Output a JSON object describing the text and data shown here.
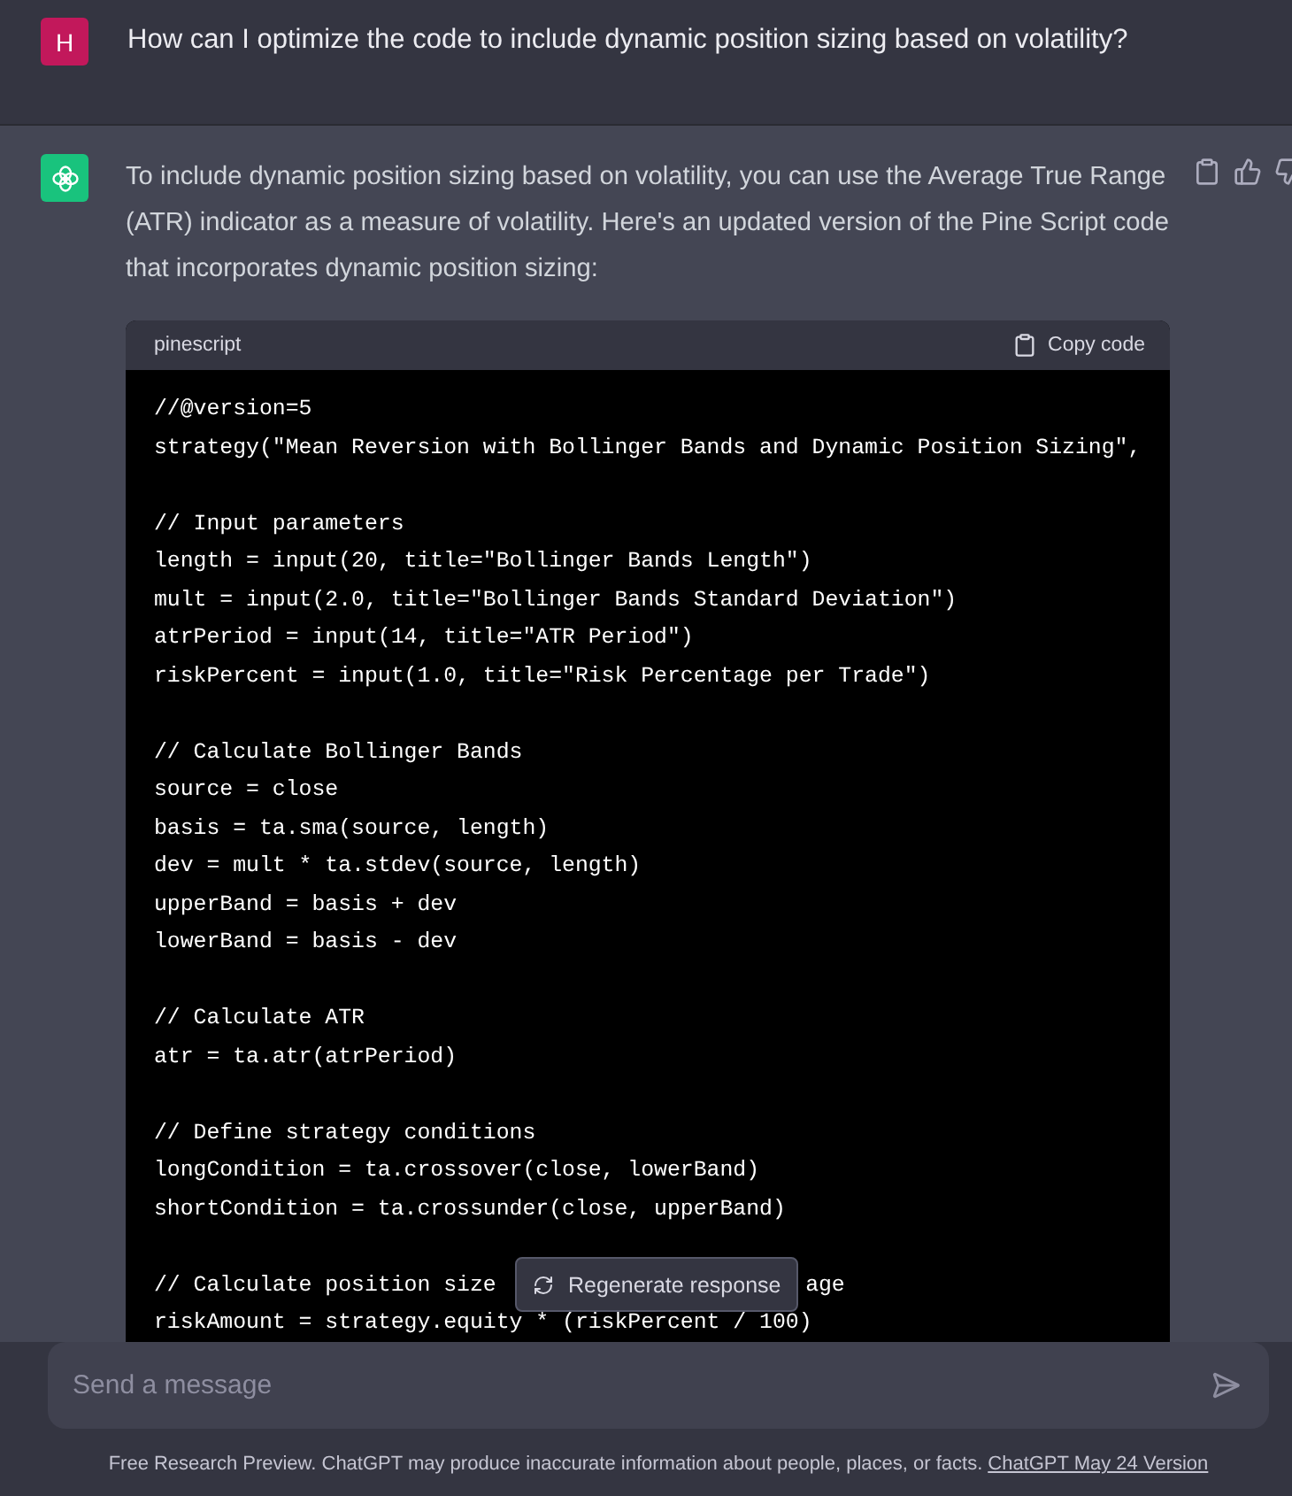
{
  "user_message": {
    "avatar": "H",
    "text": "How can I optimize the code to include dynamic position sizing based on volatility?"
  },
  "assistant_message": {
    "text": "To include dynamic position sizing based on volatility, you can use the Average True Range (ATR) indicator as a measure of volatility. Here's an updated version of the Pine Script code that incorporates dynamic position sizing:",
    "code_block": {
      "language": "pinescript",
      "copy_label": "Copy code",
      "lines": [
        {
          "kind": "code",
          "text": "//@version=5"
        },
        {
          "kind": "code",
          "text": "strategy(\"Mean Reversion with Bollinger Bands and Dynamic Position Sizing\","
        },
        {
          "kind": "blank"
        },
        {
          "kind": "code",
          "text": "// Input parameters"
        },
        {
          "kind": "code",
          "text": "length = input(20, title=\"Bollinger Bands Length\")"
        },
        {
          "kind": "code",
          "text": "mult = input(2.0, title=\"Bollinger Bands Standard Deviation\")"
        },
        {
          "kind": "code",
          "text": "atrPeriod = input(14, title=\"ATR Period\")"
        },
        {
          "kind": "code",
          "text": "riskPercent = input(1.0, title=\"Risk Percentage per Trade\")"
        },
        {
          "kind": "blank"
        },
        {
          "kind": "code",
          "text": "// Calculate Bollinger Bands"
        },
        {
          "kind": "code",
          "text": "source = close"
        },
        {
          "kind": "code",
          "text": "basis = ta.sma(source, length)"
        },
        {
          "kind": "code",
          "text": "dev = mult * ta.stdev(source, length)"
        },
        {
          "kind": "code",
          "text": "upperBand = basis + dev"
        },
        {
          "kind": "code",
          "text": "lowerBand = basis - dev"
        },
        {
          "kind": "blank"
        },
        {
          "kind": "code",
          "text": "// Calculate ATR"
        },
        {
          "kind": "code",
          "text": "atr = ta.atr(atrPeriod)"
        },
        {
          "kind": "blank"
        },
        {
          "kind": "code",
          "text": "// Define strategy conditions"
        },
        {
          "kind": "code",
          "text": "longCondition = ta.crossover(close, lowerBand)"
        },
        {
          "kind": "code",
          "text": "shortCondition = ta.crossunder(close, upperBand)"
        },
        {
          "kind": "blank"
        },
        {
          "kind": "covered",
          "text": "// Calculate position size",
          "tail": "age"
        },
        {
          "kind": "code",
          "text": "riskAmount = strategy.equity * (riskPercent / 100)"
        }
      ]
    }
  },
  "regenerate_button": "Regenerate response",
  "composer": {
    "placeholder": "Send a message"
  },
  "footer": {
    "text": "Free Research Preview. ChatGPT may produce inaccurate information about people, places, or facts.",
    "link": "ChatGPT May 24 Version"
  }
}
